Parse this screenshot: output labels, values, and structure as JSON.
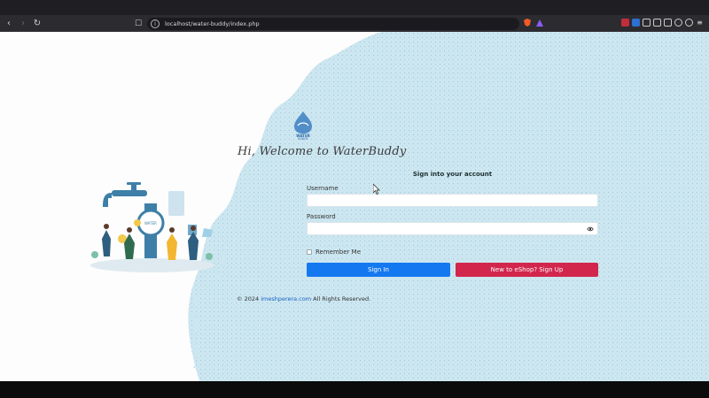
{
  "browser": {
    "url": "localhost/water-buddy/index.php",
    "back_icon": "arrow-left-icon",
    "forward_icon": "arrow-right-icon",
    "reload_icon": "reload-icon",
    "bookmark_icon": "bookmark-icon",
    "site_info_icon": "info-icon"
  },
  "brand": {
    "logo_text": "WATER BUDDY",
    "welcome": "Hi, Welcome to WaterBuddy"
  },
  "form": {
    "heading": "Sign into your account",
    "username_label": "Username",
    "username_value": "",
    "password_label": "Password",
    "password_value": "",
    "remember_label": "Remember Me",
    "remember_checked": false,
    "signin_label": "Sign In",
    "signup_label": "New to eShop? Sign Up"
  },
  "footer": {
    "prefix": "© 2024",
    "link": "imeshperera.com",
    "suffix": "All Rights Reserved."
  },
  "colors": {
    "primary": "#1479f0",
    "signup": "#d2264d",
    "water_bg": "#cde7f1",
    "water_dots": "#9cc7d8"
  }
}
